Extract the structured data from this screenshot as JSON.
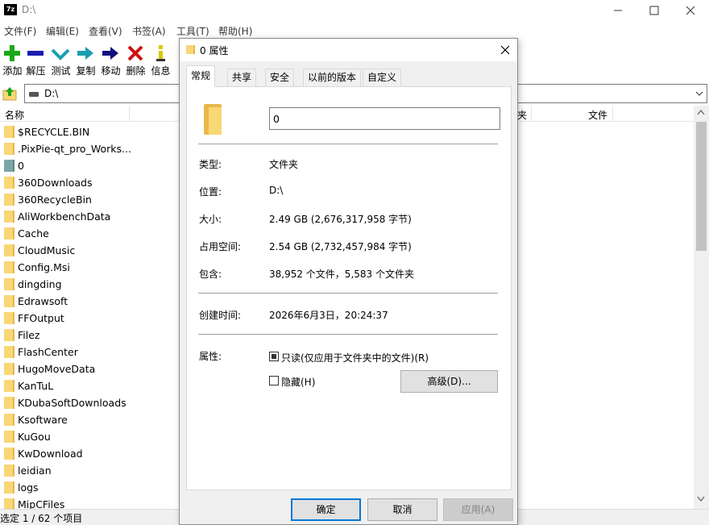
{
  "window": {
    "logo": "7z",
    "title": "D:\\",
    "min_icon": "minimize-icon",
    "max_icon": "maximize-icon",
    "close_icon": "close-icon"
  },
  "menu": [
    "文件(F)",
    "编辑(E)",
    "查看(V)",
    "书签(A)",
    "工具(T)",
    "帮助(H)"
  ],
  "toolbar": {
    "items": [
      {
        "label": "添加",
        "icon": "plus-icon",
        "color": "#1aa81a"
      },
      {
        "label": "解压",
        "icon": "minus-icon",
        "color": "#1c1cb0"
      },
      {
        "label": "测试",
        "icon": "check-icon",
        "color": "#1a9fb0"
      },
      {
        "label": "复制",
        "icon": "double-arrow-right-icon",
        "color": "#1a9fb0"
      },
      {
        "label": "移动",
        "icon": "arrow-right-icon",
        "color": "#101080"
      },
      {
        "label": "删除",
        "icon": "x-icon",
        "color": "#d01010"
      },
      {
        "label": "信息",
        "icon": "info-icon",
        "color": "#d8c800"
      }
    ]
  },
  "address": {
    "path": "D:\\"
  },
  "list_header": {
    "name": "名称",
    "partial_col1": "夹",
    "partial_col2": "文件"
  },
  "files": [
    "$RECYCLE.BIN",
    ".PixPie-qt_pro_Works...",
    "0",
    "360Downloads",
    "360RecycleBin",
    "AliWorkbenchData",
    "Cache",
    "CloudMusic",
    "Config.Msi",
    "dingding",
    "Edrawsoft",
    "FFOutput",
    "Filez",
    "FlashCenter",
    "HugoMoveData",
    "KanTuL",
    "KDubaSoftDownloads",
    "Ksoftware",
    "KuGou",
    "KwDownload",
    "leidian",
    "logs",
    "MipCFiles"
  ],
  "status": {
    "text": "选定 1 / 62 个项目"
  },
  "dialog": {
    "title": "0 属性",
    "tabs": [
      "常规",
      "共享",
      "安全",
      "以前的版本",
      "自定义"
    ],
    "active_tab": "常规",
    "name_value": "0",
    "props": {
      "type_label": "类型:",
      "type_value": "文件夹",
      "location_label": "位置:",
      "location_value": "D:\\",
      "size_label": "大小:",
      "size_value": "2.49 GB (2,676,317,958 字节)",
      "disk_label": "占用空间:",
      "disk_value": "2.54 GB (2,732,457,984 字节)",
      "contains_label": "包含:",
      "contains_value": "38,952 个文件，5,583 个文件夹",
      "created_label": "创建时间:",
      "created_value": "2026年6月3日，20:24:37",
      "attr_label": "属性:",
      "readonly_label": "只读(仅应用于文件夹中的文件)(R)",
      "readonly_checked": true,
      "hidden_label": "隐藏(H)",
      "hidden_checked": false,
      "advanced_label": "高级(D)..."
    },
    "buttons": {
      "ok": "确定",
      "cancel": "取消",
      "apply": "应用(A)"
    }
  }
}
